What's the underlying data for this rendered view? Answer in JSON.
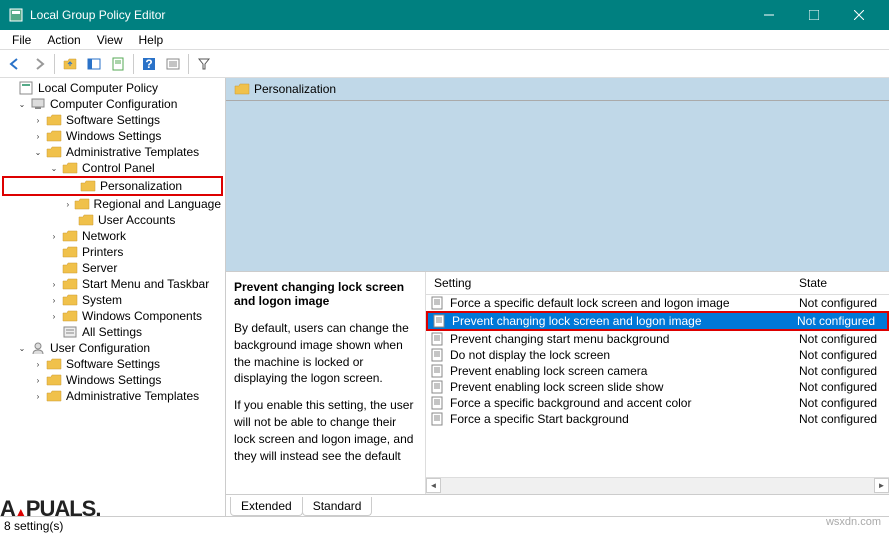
{
  "window": {
    "title": "Local Group Policy Editor"
  },
  "menu": {
    "file": "File",
    "action": "Action",
    "view": "View",
    "help": "Help"
  },
  "tree": {
    "root": "Local Computer Policy",
    "computer_config": "Computer Configuration",
    "software_settings": "Software Settings",
    "windows_settings": "Windows Settings",
    "admin_templates": "Administrative Templates",
    "control_panel": "Control Panel",
    "personalization": "Personalization",
    "regional": "Regional and Language",
    "user_accounts": "User Accounts",
    "network": "Network",
    "printers": "Printers",
    "server": "Server",
    "start_menu": "Start Menu and Taskbar",
    "system": "System",
    "windows_components": "Windows Components",
    "all_settings": "All Settings",
    "user_config": "User Configuration",
    "software_settings2": "Software Settings",
    "windows_settings2": "Windows Settings",
    "admin_templates2": "Administrative Templates"
  },
  "detail": {
    "crumb": "Personalization",
    "selected_title": "Prevent changing lock screen and logon image",
    "desc_line1": "By default, users can change the background image shown when the machine is locked or displaying the logon screen.",
    "desc_line2": "If you enable this setting, the user will not be able to change their lock screen and logon image, and they will instead see the default",
    "header_setting": "Setting",
    "header_state": "State"
  },
  "settings": [
    {
      "name": "Force a specific default lock screen and logon image",
      "state": "Not configured"
    },
    {
      "name": "Prevent changing lock screen and logon image",
      "state": "Not configured",
      "selected": true
    },
    {
      "name": "Prevent changing start menu background",
      "state": "Not configured"
    },
    {
      "name": "Do not display the lock screen",
      "state": "Not configured"
    },
    {
      "name": "Prevent enabling lock screen camera",
      "state": "Not configured"
    },
    {
      "name": "Prevent enabling lock screen slide show",
      "state": "Not configured"
    },
    {
      "name": "Force a specific background and accent color",
      "state": "Not configured"
    },
    {
      "name": "Force a specific Start background",
      "state": "Not configured"
    }
  ],
  "tabs": {
    "extended": "Extended",
    "standard": "Standard"
  },
  "status": "8 setting(s)",
  "watermark": "wsxdn.com",
  "logo": "A▲PUALS."
}
